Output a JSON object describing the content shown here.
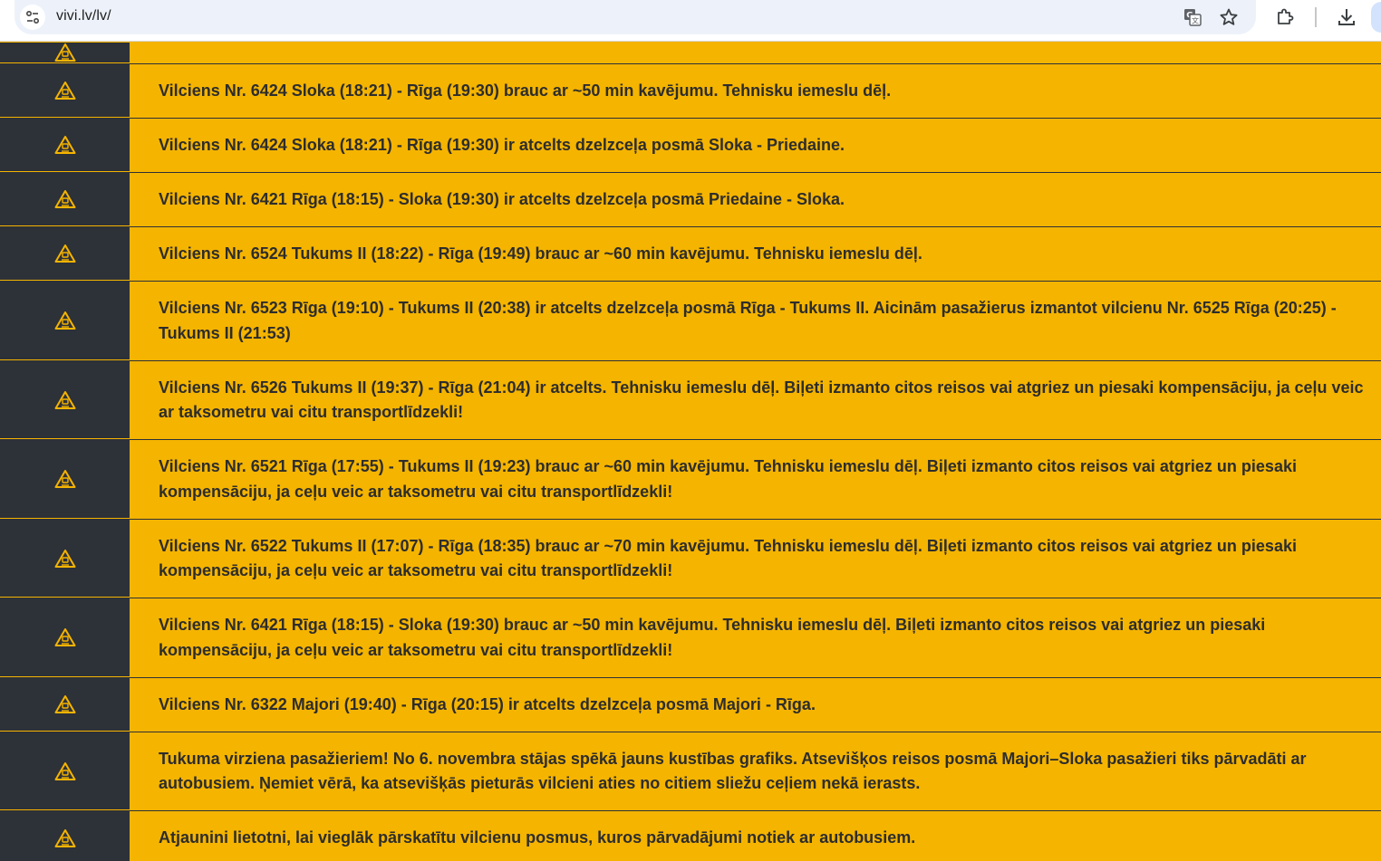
{
  "browser": {
    "url": "vivi.lv/lv/",
    "icons": [
      "site-settings-icon",
      "translate-icon",
      "bookmark-star-icon",
      "extensions-icon",
      "download-icon"
    ]
  },
  "colors": {
    "alert_background": "#f5b400",
    "icon_column": "#2d3138",
    "text": "#2d2d2d"
  },
  "alerts": [
    {
      "icon": "warning-train-icon",
      "text": ""
    },
    {
      "icon": "warning-train-icon",
      "text": "Vilciens Nr. 6424 Sloka (18:21) - Rīga (19:30) brauc ar ~50 min kavējumu. Tehnisku iemeslu dēļ."
    },
    {
      "icon": "warning-train-icon",
      "text": "Vilciens Nr. 6424 Sloka (18:21) - Rīga (19:30) ir atcelts dzelzceļa posmā Sloka - Priedaine."
    },
    {
      "icon": "warning-train-icon",
      "text": "Vilciens Nr. 6421 Rīga (18:15) - Sloka (19:30) ir atcelts dzelzceļa posmā Priedaine - Sloka."
    },
    {
      "icon": "warning-train-icon",
      "text": "Vilciens Nr. 6524 Tukums II (18:22) - Rīga (19:49) brauc ar ~60 min kavējumu. Tehnisku iemeslu dēļ."
    },
    {
      "icon": "warning-train-icon",
      "text": "Vilciens Nr. 6523 Rīga (19:10) - Tukums II (20:38) ir atcelts dzelzceļa posmā Rīga - Tukums II. Aicinām pasažierus izmantot vilcienu Nr. 6525 Rīga (20:25) - Tukums II (21:53)"
    },
    {
      "icon": "warning-train-icon",
      "text": "Vilciens Nr. 6526 Tukums II (19:37) - Rīga (21:04) ir atcelts. Tehnisku iemeslu dēļ. Biļeti izmanto citos reisos vai atgriez un piesaki kompensāciju, ja ceļu veic ar taksometru vai citu transportlīdzekli!"
    },
    {
      "icon": "warning-train-icon",
      "text": "Vilciens Nr. 6521 Rīga (17:55) - Tukums II (19:23) brauc ar ~60 min kavējumu. Tehnisku iemeslu dēļ. Biļeti izmanto citos reisos vai atgriez un piesaki kompensāciju, ja ceļu veic ar taksometru vai citu transportlīdzekli!"
    },
    {
      "icon": "warning-train-icon",
      "text": "Vilciens Nr. 6522 Tukums II (17:07) - Rīga (18:35) brauc ar ~70 min kavējumu. Tehnisku iemeslu dēļ. Biļeti izmanto citos reisos vai atgriez un piesaki kompensāciju, ja ceļu veic ar taksometru vai citu transportlīdzekli!"
    },
    {
      "icon": "warning-train-icon",
      "text": "Vilciens Nr. 6421 Rīga (18:15) - Sloka (19:30) brauc ar ~50 min kavējumu. Tehnisku iemeslu dēļ. Biļeti izmanto citos reisos vai atgriez un piesaki kompensāciju, ja ceļu veic ar taksometru vai citu transportlīdzekli!"
    },
    {
      "icon": "warning-train-icon",
      "text": "Vilciens Nr. 6322 Majori (19:40) - Rīga (20:15) ir atcelts dzelzceļa posmā Majori - Rīga."
    },
    {
      "icon": "warning-train-icon",
      "text": "Tukuma virziena pasažieriem! No 6. novembra stājas spēkā jauns kustības grafiks. Atsevišķos reisos posmā Majori–Sloka pasažieri tiks pārvadāti ar autobusiem. Ņemiet vērā, ka atsevišķās pieturās vilcieni aties no citiem sliežu ceļiem nekā ierasts."
    },
    {
      "icon": "warning-train-icon",
      "text": "Atjaunini lietotni, lai vieglāk pārskatītu vilcienu posmus, kuros pārvadājumi notiek ar autobusiem."
    }
  ]
}
